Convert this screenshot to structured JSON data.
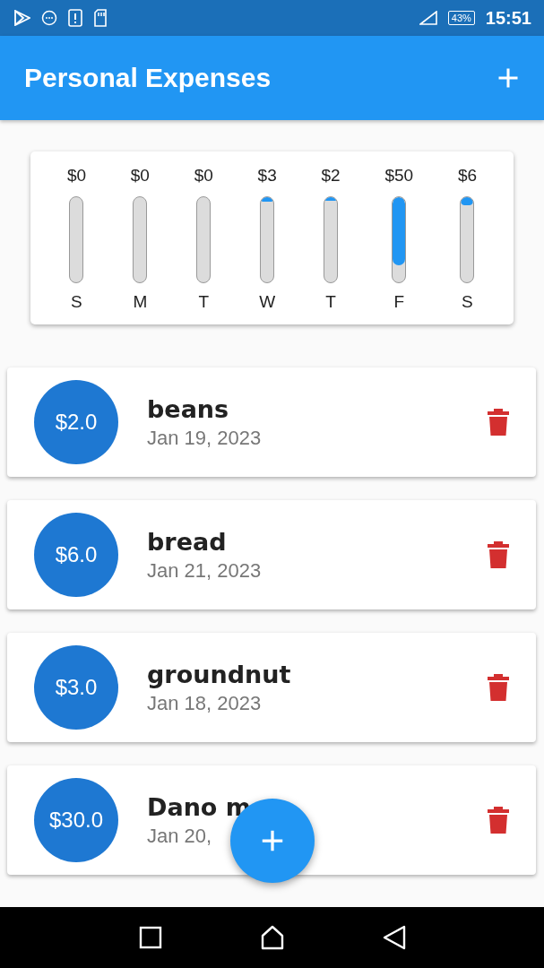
{
  "status_bar": {
    "battery": "43%",
    "time": "15:51"
  },
  "app_bar": {
    "title": "Personal Expenses"
  },
  "chart": [
    {
      "amount": "$0",
      "day": "S"
    },
    {
      "amount": "$0",
      "day": "M"
    },
    {
      "amount": "$0",
      "day": "T"
    },
    {
      "amount": "$3",
      "day": "W",
      "level": 0.05
    },
    {
      "amount": "$2",
      "day": "T",
      "level": 0.03
    },
    {
      "amount": "$50",
      "day": "F",
      "level": 0.8
    },
    {
      "amount": "$6",
      "day": "S",
      "level": 0.09
    }
  ],
  "transactions": [
    {
      "amount": "$2.0",
      "title": "beans",
      "date": "Jan 19, 2023"
    },
    {
      "amount": "$6.0",
      "title": "bread",
      "date": "Jan 21, 2023"
    },
    {
      "amount": "$3.0",
      "title": "groundnut",
      "date": "Jan 18, 2023"
    },
    {
      "amount": "$30.0",
      "title": "Dano m",
      "date": "Jan 20,"
    }
  ]
}
